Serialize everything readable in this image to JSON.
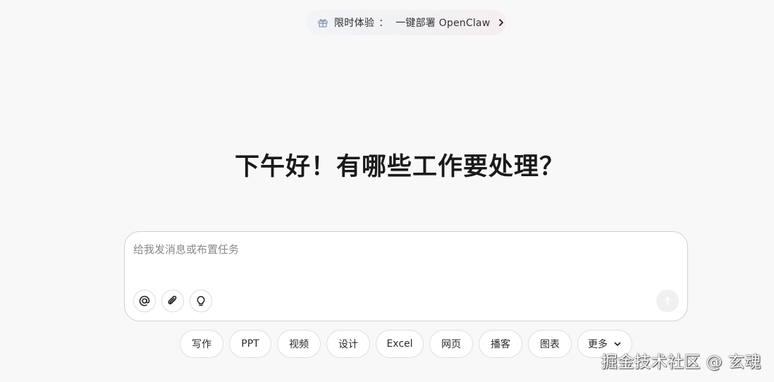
{
  "promo": {
    "tag": "限时体验",
    "separator": "：",
    "text": "一键部署 OpenClaw",
    "icon": "gift-icon"
  },
  "greeting": "下午好！有哪些工作要处理？",
  "composer": {
    "placeholder": "给我发消息或布置任务",
    "value": "",
    "tools": [
      "at-icon",
      "paperclip-icon",
      "lightbulb-icon"
    ],
    "send_icon": "send-arrow-icon"
  },
  "chips": {
    "write": "写作",
    "ppt": "PPT",
    "video": "视频",
    "design": "设计",
    "excel": "Excel",
    "webpage": "网页",
    "podcast": "播客",
    "chart": "图表",
    "more": "更多"
  },
  "watermark": "掘金技术社区 @ 玄魂"
}
